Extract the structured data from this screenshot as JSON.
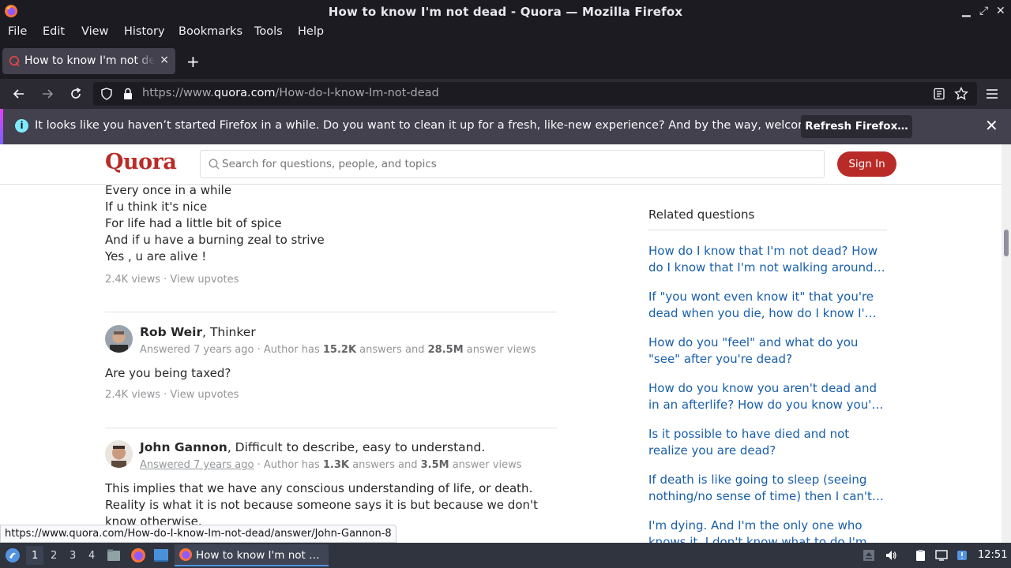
{
  "window": {
    "title": "How to know I'm not dead - Quora — Mozilla Firefox",
    "minimize": "▁",
    "maximize": "⤢",
    "close": "✕"
  },
  "menubar": [
    "File",
    "Edit",
    "View",
    "History",
    "Bookmarks",
    "Tools",
    "Help"
  ],
  "tab": {
    "label": "How to know I'm not dead - Quora",
    "close": "×",
    "new_tab": "+"
  },
  "url": {
    "prefix": "https://www.",
    "domain": "quora.com",
    "path": "/How-do-I-know-Im-not-dead"
  },
  "notification": {
    "info": "i",
    "message": "It looks like you haven’t started Firefox in a while. Do you want to clean it up for a fresh, like-new experience? And by the way, welcome back!",
    "button": "Refresh Firefox…",
    "close": "✕"
  },
  "quora": {
    "logo": "Quora",
    "search_placeholder": "Search for questions, people, and topics",
    "signin": "Sign In"
  },
  "feed": {
    "poem_lines": [
      "Every once in a while",
      "If u think it's nice",
      "For life had a little bit of spice",
      "And if u have a burning zeal to strive",
      "Yes , u are alive !"
    ],
    "poem_meta": "2.4K views · View upvotes",
    "answers": [
      {
        "name": "Rob Weir",
        "cred": ", Thinker",
        "answered": "Answered 7 years ago",
        "stats_prefix": " · Author has ",
        "answers_count": "15.2K",
        "answers_mid": " answers and ",
        "views_count": "28.5M",
        "views_suffix": " answer views",
        "body": "Are you being taxed?",
        "meta": "2.4K views · View upvotes"
      },
      {
        "name": "John Gannon",
        "cred": ", Difficult to describe, easy to understand.",
        "answered": "Answered 7 years ago",
        "stats_prefix": " · Author has ",
        "answers_count": "1.3K",
        "answers_mid": " answers and ",
        "views_count": "3.5M",
        "views_suffix": " answer views",
        "body_line1": "This implies that we have any conscious understanding of life, or death.",
        "body_line2": "Reality is what it is not because someone says it is but because we don't",
        "body_line3": "know otherwise."
      }
    ]
  },
  "related": {
    "heading": "Related questions",
    "questions": [
      [
        "How do I know that I'm not dead? How",
        "do I know that I'm not walking around…"
      ],
      [
        "If \"you wont even know it\" that you're",
        "dead when you die, how do I know I'…"
      ],
      [
        "How do you \"feel\" and what do you",
        "\"see\" after you're dead?"
      ],
      [
        "How do you know you aren't dead and",
        "in an afterlife? How do you know you'…"
      ],
      [
        "Is it possible to have died and not",
        "realize you are dead?"
      ],
      [
        "If death is like going to sleep (seeing",
        "nothing/no sense of time) then I can't…"
      ],
      [
        "I'm dying. And I'm the only one who",
        "knows it. I don't know what to do I'm…"
      ]
    ]
  },
  "statusbar": "https://www.quora.com/How-do-I-know-Im-not-dead/answer/John-Gannon-8",
  "taskbar": {
    "workspaces": [
      "1",
      "2",
      "3",
      "4"
    ],
    "active_workspace": "1",
    "task_label": "How to know I'm not …",
    "clock": "12:51"
  },
  "colors": {
    "quora_red": "#b92b27",
    "link_blue": "#195faa",
    "firefox_dark": "#1c1b22"
  }
}
